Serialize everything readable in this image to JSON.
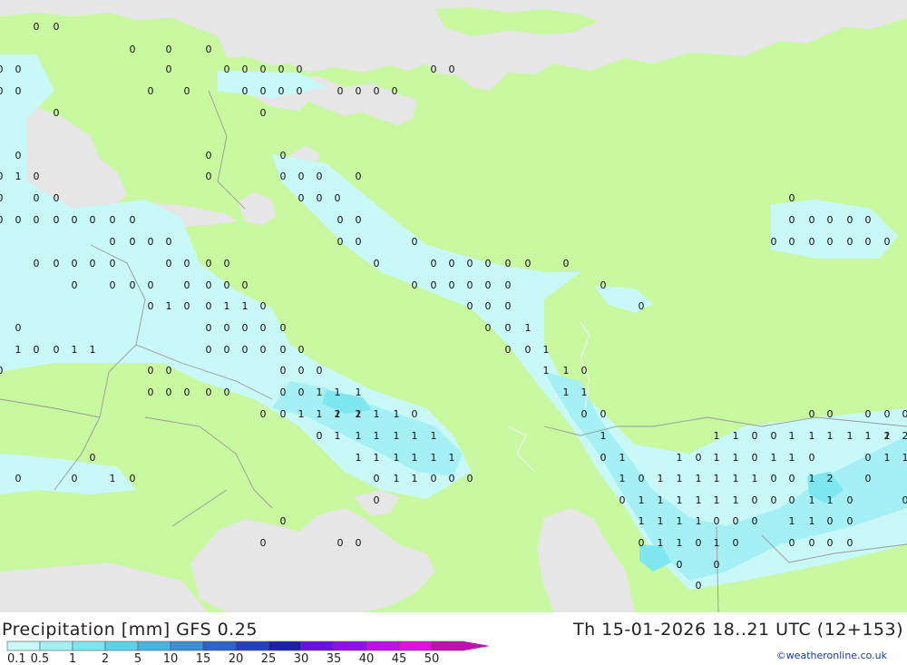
{
  "title": "Precipitation [mm] GFS 0.25",
  "valid_time": "Th 15-01-2026 18..21 UTC (12+153)",
  "credit": "©weatheronline.co.uk",
  "legend": {
    "labels": [
      "0.1",
      "0.5",
      "1",
      "2",
      "5",
      "10",
      "15",
      "20",
      "25",
      "30",
      "35",
      "40",
      "45",
      "50"
    ],
    "colors": [
      "#c8f8f8",
      "#a4f0f4",
      "#7ee6ee",
      "#5cd2e6",
      "#46b4dc",
      "#3c8ed6",
      "#2e62cc",
      "#2440bc",
      "#1c22a8",
      "#6a10e0",
      "#9010e8",
      "#c010e8",
      "#e010e0",
      "#c010b0"
    ]
  },
  "colors": {
    "land": "#c8f8a0",
    "sea": "#e6e6e6",
    "precip_light": "#c8f8f8",
    "precip_mid": "#a4f0f4",
    "precip_heavy": "#7ee6ee",
    "border": "#9a9a9a"
  },
  "map_values": [
    [
      "0",
      "0",
      "0",
      "0",
      "0",
      "0",
      "0",
      "0",
      "0",
      "0",
      "0",
      "0",
      "0",
      "0",
      "0",
      "0",
      "0",
      "0",
      "0",
      "0",
      "0",
      "0",
      "0",
      "0",
      "0",
      "0",
      "0",
      "0",
      "0",
      "0",
      "0",
      "0",
      "0",
      "0",
      "0",
      "0",
      "0",
      "0",
      "0",
      "0",
      "0",
      "0",
      "0",
      "0",
      "0",
      "0",
      "0",
      "0",
      "0",
      "0"
    ],
    [
      "1",
      "1",
      "1",
      "1",
      "1",
      "1",
      "1",
      "1",
      "2",
      "1",
      "1",
      "1",
      "1",
      "1",
      "1",
      "1",
      "1",
      "1",
      "1",
      "1",
      "1",
      "1",
      "1",
      "1",
      "1",
      "1",
      "1",
      "1",
      "1",
      "1",
      "1",
      "1",
      "1",
      "1",
      "1",
      "1",
      "1",
      "2",
      "1",
      "1",
      "1",
      "1",
      "1",
      "2",
      "2",
      "1",
      "1",
      "1",
      "1",
      "1"
    ]
  ]
}
